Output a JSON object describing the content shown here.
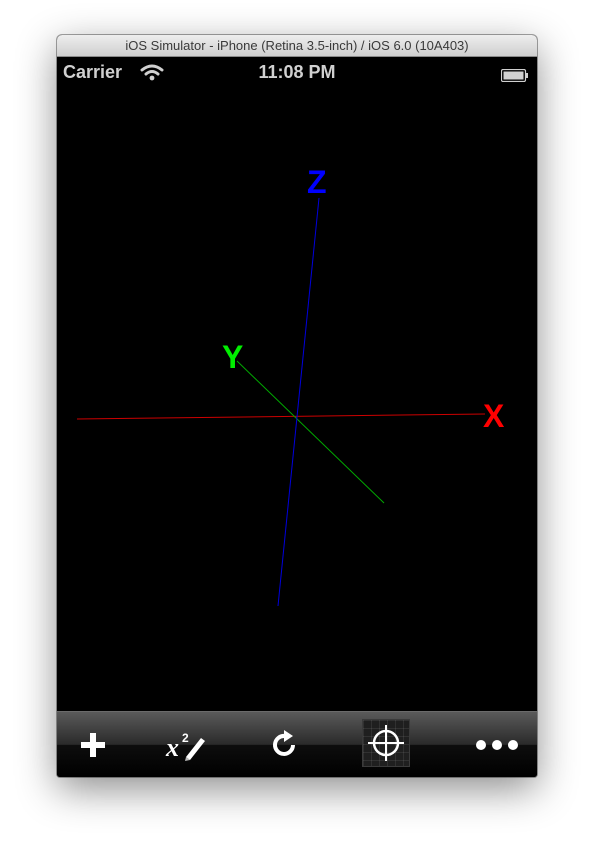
{
  "window": {
    "title": "iOS Simulator - iPhone (Retina 3.5-inch) / iOS 6.0 (10A403)"
  },
  "status_bar": {
    "carrier": "Carrier",
    "time": "11:08 PM",
    "wifi_icon": "wifi-icon",
    "battery_icon": "battery-icon"
  },
  "axes": {
    "x_label": "X",
    "y_label": "Y",
    "z_label": "Z",
    "x_color": "#ff0000",
    "y_color": "#00ee00",
    "z_color": "#0000ff"
  },
  "toolbar": {
    "items": [
      {
        "icon": "plus-icon"
      },
      {
        "icon": "function-edit-icon"
      },
      {
        "icon": "refresh-icon"
      },
      {
        "icon": "crosshair-target-icon"
      },
      {
        "icon": "more-dots-icon"
      }
    ]
  }
}
